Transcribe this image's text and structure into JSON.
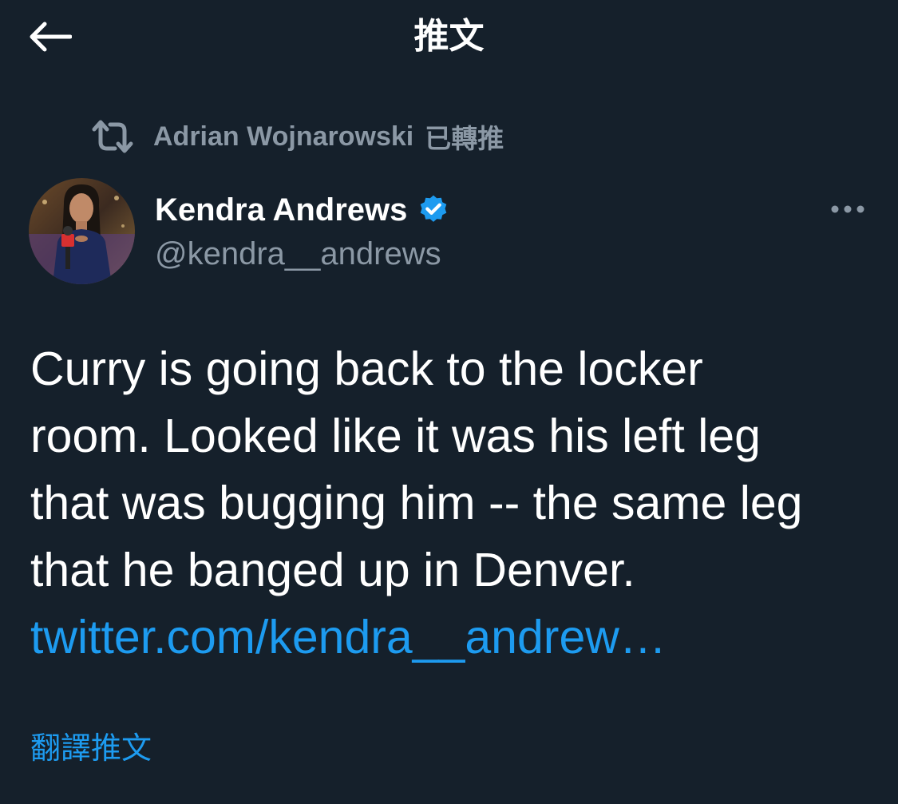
{
  "header": {
    "title": "推文",
    "back_icon": "arrow-left-icon"
  },
  "retweet": {
    "icon": "retweet-icon",
    "retweeter_name": "Adrian Wojnarowski",
    "suffix": "已轉推",
    "color": "#8b98a5"
  },
  "tweet": {
    "author_name": "Kendra Andrews",
    "verified_icon": "verified-badge-icon",
    "author_handle": "@kendra__andrews",
    "more_icon": "more-horizontal-icon",
    "text_lines": [
      "Curry is going back to the locker",
      "room. Looked like it was his left leg",
      "that was bugging him -- the same leg",
      "that he banged up in Denver."
    ],
    "link_text": "twitter.com/kendra__andrew…",
    "translate_label": "翻譯推文"
  },
  "colors": {
    "background": "#15202b",
    "accent": "#1d9bf0",
    "secondary_text": "#8b98a5",
    "primary_text": "#ffffff"
  }
}
